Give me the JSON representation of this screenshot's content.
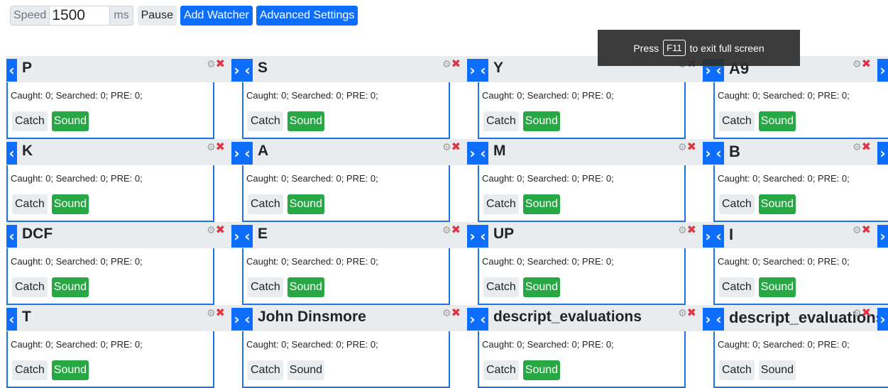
{
  "toolbar": {
    "speed_label": "Speed",
    "speed_value": "1500",
    "ms_label": "ms",
    "pause_label": "Pause",
    "add_watcher_label": "Add Watcher",
    "advanced_settings_label": "Advanced Settings"
  },
  "overlay": {
    "press": "Press",
    "key": "F11",
    "rest": "to exit full screen"
  },
  "icons": {
    "left": "‹",
    "right": "›",
    "gear": "⚙",
    "close": "✖"
  },
  "colors": {
    "primary": "#0d6efd",
    "success": "#28a745",
    "danger": "#dc3545",
    "header_bg": "#e9ecef"
  },
  "watchers": [
    {
      "name": "P",
      "stats": "Caught: 0; Searched: 0; PRE: 0;",
      "catch": "Catch",
      "sound": "Sound",
      "sound_on": true
    },
    {
      "name": "S",
      "stats": "Caught: 0; Searched: 0; PRE: 0;",
      "catch": "Catch",
      "sound": "Sound",
      "sound_on": true
    },
    {
      "name": "Y",
      "stats": "Caught: 0; Searched: 0; PRE: 0;",
      "catch": "Catch",
      "sound": "Sound",
      "sound_on": true
    },
    {
      "name": "A9",
      "stats": "Caught: 0; Searched: 0; PRE: 0;",
      "catch": "Catch",
      "sound": "Sound",
      "sound_on": true
    },
    {
      "name": "K",
      "stats": "Caught: 0; Searched: 0; PRE: 0;",
      "catch": "Catch",
      "sound": "Sound",
      "sound_on": true
    },
    {
      "name": "A",
      "stats": "Caught: 0; Searched: 0; PRE: 0;",
      "catch": "Catch",
      "sound": "Sound",
      "sound_on": true
    },
    {
      "name": "M",
      "stats": "Caught: 0; Searched: 0; PRE: 0;",
      "catch": "Catch",
      "sound": "Sound",
      "sound_on": true
    },
    {
      "name": "B",
      "stats": "Caught: 0; Searched: 0; PRE: 0;",
      "catch": "Catch",
      "sound": "Sound",
      "sound_on": true
    },
    {
      "name": "DCF",
      "stats": "Caught: 0; Searched: 0; PRE: 0;",
      "catch": "Catch",
      "sound": "Sound",
      "sound_on": true
    },
    {
      "name": "E",
      "stats": "Caught: 0; Searched: 0; PRE: 0;",
      "catch": "Catch",
      "sound": "Sound",
      "sound_on": true
    },
    {
      "name": "UP",
      "stats": "Caught: 0; Searched: 0; PRE: 0;",
      "catch": "Catch",
      "sound": "Sound",
      "sound_on": true
    },
    {
      "name": "I",
      "stats": "Caught: 0; Searched: 0; PRE: 0;",
      "catch": "Catch",
      "sound": "Sound",
      "sound_on": true
    },
    {
      "name": "T",
      "stats": "Caught: 0; Searched: 0; PRE: 0;",
      "catch": "Catch",
      "sound": "Sound",
      "sound_on": true
    },
    {
      "name": "John Dinsmore",
      "stats": "Caught: 0; Searched: 0; PRE: 0;",
      "catch": "Catch",
      "sound": "Sound",
      "sound_on": false
    },
    {
      "name": "descript_evaluations",
      "stats": "Caught: 0; Searched: 0; PRE: 0;",
      "catch": "Catch",
      "sound": "Sound",
      "sound_on": true
    },
    {
      "name": "descript_evaluations",
      "stats": "Caught: 0; Searched: 0; PRE: 0;",
      "catch": "Catch",
      "sound": "Sound",
      "sound_on": false
    }
  ]
}
